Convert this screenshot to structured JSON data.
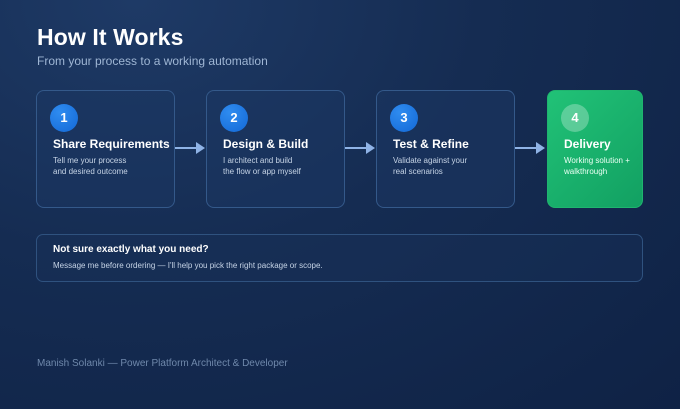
{
  "header": {
    "title": "How It Works",
    "subtitle": "From your process to a working automation"
  },
  "steps": [
    {
      "number": "1",
      "title": "Share Requirements",
      "desc_line1": "Tell me your process",
      "desc_line2": "and desired outcome"
    },
    {
      "number": "2",
      "title": "Design & Build",
      "desc_line1": "I architect and build",
      "desc_line2": "the flow or app myself"
    },
    {
      "number": "3",
      "title": "Test & Refine",
      "desc_line1": "Validate against your",
      "desc_line2": "real scenarios"
    },
    {
      "number": "4",
      "title": "Delivery",
      "desc_line1": "Working solution +",
      "desc_line2": "walkthrough"
    }
  ],
  "note": {
    "title": "Not sure exactly what you need?",
    "text": "Message me before ordering — I'll help you pick the right package or scope."
  },
  "footer": {
    "text": "Manish Solanki — Power Platform Architect & Developer"
  },
  "colors": {
    "accent_blue": "#1f7be3",
    "delivery_green": "#1bb56d",
    "arrow": "#8fb3e6"
  }
}
